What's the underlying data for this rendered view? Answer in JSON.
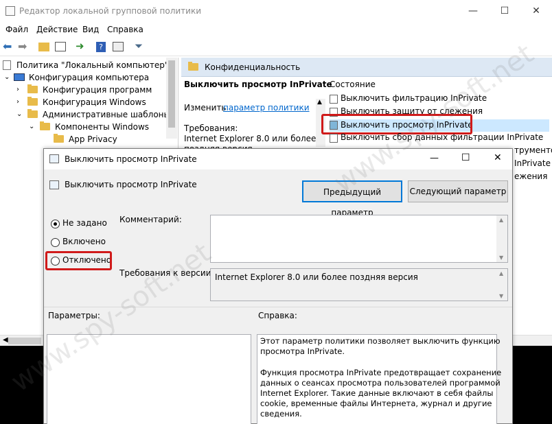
{
  "main_window": {
    "title": "Редактор локальной групповой политики",
    "menu": [
      "Файл",
      "Действие",
      "Вид",
      "Справка"
    ],
    "tree": {
      "root": "Политика \"Локальный компьютер\"",
      "items": [
        "Конфигурация компьютера",
        "Конфигурация программ",
        "Конфигурация Windows",
        "Административные шаблоны",
        "Компоненты Windows",
        "App Privacy"
      ]
    },
    "right": {
      "folder_title": "Конфиденциальность",
      "policy_title": "Выключить просмотр InPrivate",
      "edit_prefix": "Изменить",
      "edit_link": "параметр политики",
      "requirements_label": "Требования:",
      "requirements_text": "Internet Explorer 8.0 или более",
      "requirements_text2": "поздняя версия",
      "column_state": "Состояние",
      "list": [
        "Выключить фильтрацию InPrivate",
        "Выключить защиту от слежения",
        "Выключить просмотр InPrivate",
        "Выключить сбор данных фильтрации InPrivate",
        "трументов",
        "InPrivate",
        "ежения"
      ]
    }
  },
  "dialog": {
    "title": "Выключить просмотр InPrivate",
    "header": "Выключить просмотр InPrivate",
    "prev_button": "Предыдущий параметр",
    "next_button": "Следующий параметр",
    "radios": [
      "Не задано",
      "Включено",
      "Отключено"
    ],
    "comment_label": "Комментарий:",
    "version_label": "Требования к версии:",
    "version_value": "Internet Explorer 8.0 или более поздняя версия",
    "params_label": "Параметры:",
    "help_label": "Справка:",
    "help_p1_l1": "Этот параметр политики позволяет выключить функцию",
    "help_p1_l2": "просмотра InPrivate.",
    "help_p2_l1": "Функция просмотра InPrivate предотвращает сохранение",
    "help_p2_l2": "данных о сеансах просмотра пользователей программой",
    "help_p2_l3": "Internet Explorer. Такие данные включают в себя файлы",
    "help_p2_l4": "cookie, временные файлы Интернета, журнал и другие",
    "help_p2_l5": "сведения."
  },
  "watermark": "www.spy-soft.net",
  "colors": {
    "highlight_red": "#d01a1a",
    "link_blue": "#0066cc",
    "selected_bg": "#cce8ff"
  }
}
